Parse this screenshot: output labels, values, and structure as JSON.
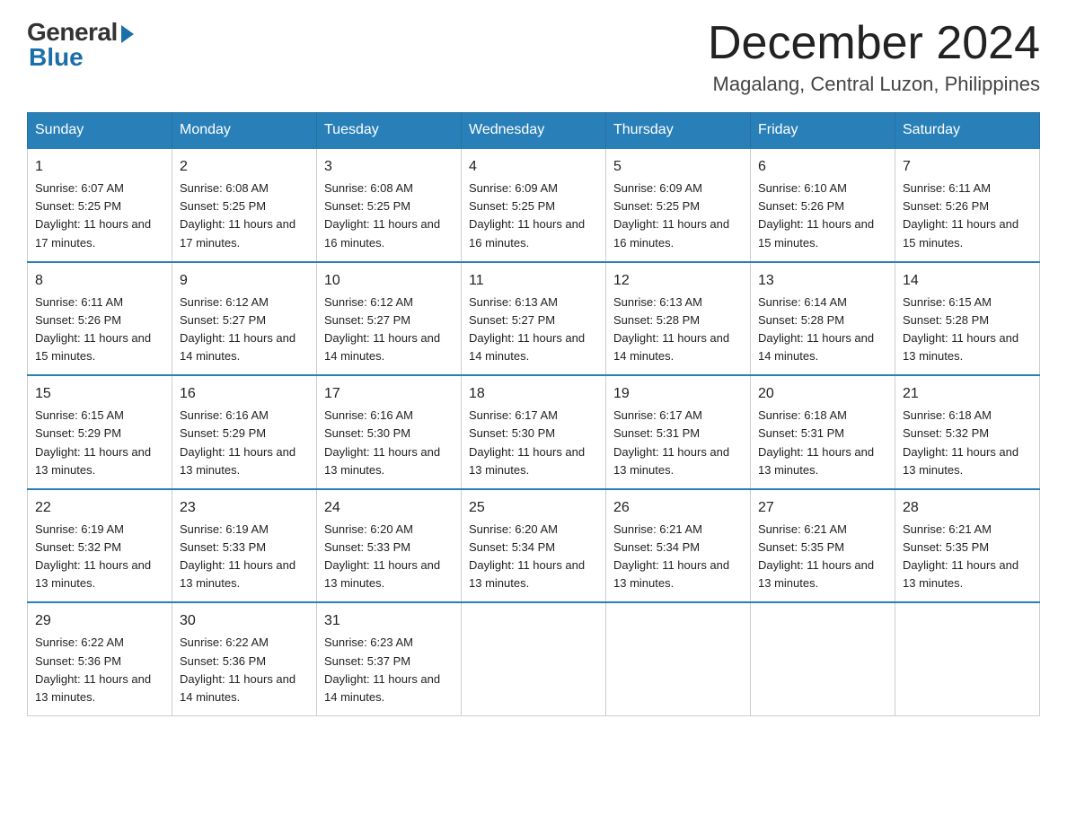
{
  "logo": {
    "general": "General",
    "blue": "Blue"
  },
  "title": "December 2024",
  "location": "Magalang, Central Luzon, Philippines",
  "days_of_week": [
    "Sunday",
    "Monday",
    "Tuesday",
    "Wednesday",
    "Thursday",
    "Friday",
    "Saturday"
  ],
  "weeks": [
    [
      {
        "day": "1",
        "sunrise": "6:07 AM",
        "sunset": "5:25 PM",
        "daylight": "11 hours and 17 minutes."
      },
      {
        "day": "2",
        "sunrise": "6:08 AM",
        "sunset": "5:25 PM",
        "daylight": "11 hours and 17 minutes."
      },
      {
        "day": "3",
        "sunrise": "6:08 AM",
        "sunset": "5:25 PM",
        "daylight": "11 hours and 16 minutes."
      },
      {
        "day": "4",
        "sunrise": "6:09 AM",
        "sunset": "5:25 PM",
        "daylight": "11 hours and 16 minutes."
      },
      {
        "day": "5",
        "sunrise": "6:09 AM",
        "sunset": "5:25 PM",
        "daylight": "11 hours and 16 minutes."
      },
      {
        "day": "6",
        "sunrise": "6:10 AM",
        "sunset": "5:26 PM",
        "daylight": "11 hours and 15 minutes."
      },
      {
        "day": "7",
        "sunrise": "6:11 AM",
        "sunset": "5:26 PM",
        "daylight": "11 hours and 15 minutes."
      }
    ],
    [
      {
        "day": "8",
        "sunrise": "6:11 AM",
        "sunset": "5:26 PM",
        "daylight": "11 hours and 15 minutes."
      },
      {
        "day": "9",
        "sunrise": "6:12 AM",
        "sunset": "5:27 PM",
        "daylight": "11 hours and 14 minutes."
      },
      {
        "day": "10",
        "sunrise": "6:12 AM",
        "sunset": "5:27 PM",
        "daylight": "11 hours and 14 minutes."
      },
      {
        "day": "11",
        "sunrise": "6:13 AM",
        "sunset": "5:27 PM",
        "daylight": "11 hours and 14 minutes."
      },
      {
        "day": "12",
        "sunrise": "6:13 AM",
        "sunset": "5:28 PM",
        "daylight": "11 hours and 14 minutes."
      },
      {
        "day": "13",
        "sunrise": "6:14 AM",
        "sunset": "5:28 PM",
        "daylight": "11 hours and 14 minutes."
      },
      {
        "day": "14",
        "sunrise": "6:15 AM",
        "sunset": "5:28 PM",
        "daylight": "11 hours and 13 minutes."
      }
    ],
    [
      {
        "day": "15",
        "sunrise": "6:15 AM",
        "sunset": "5:29 PM",
        "daylight": "11 hours and 13 minutes."
      },
      {
        "day": "16",
        "sunrise": "6:16 AM",
        "sunset": "5:29 PM",
        "daylight": "11 hours and 13 minutes."
      },
      {
        "day": "17",
        "sunrise": "6:16 AM",
        "sunset": "5:30 PM",
        "daylight": "11 hours and 13 minutes."
      },
      {
        "day": "18",
        "sunrise": "6:17 AM",
        "sunset": "5:30 PM",
        "daylight": "11 hours and 13 minutes."
      },
      {
        "day": "19",
        "sunrise": "6:17 AM",
        "sunset": "5:31 PM",
        "daylight": "11 hours and 13 minutes."
      },
      {
        "day": "20",
        "sunrise": "6:18 AM",
        "sunset": "5:31 PM",
        "daylight": "11 hours and 13 minutes."
      },
      {
        "day": "21",
        "sunrise": "6:18 AM",
        "sunset": "5:32 PM",
        "daylight": "11 hours and 13 minutes."
      }
    ],
    [
      {
        "day": "22",
        "sunrise": "6:19 AM",
        "sunset": "5:32 PM",
        "daylight": "11 hours and 13 minutes."
      },
      {
        "day": "23",
        "sunrise": "6:19 AM",
        "sunset": "5:33 PM",
        "daylight": "11 hours and 13 minutes."
      },
      {
        "day": "24",
        "sunrise": "6:20 AM",
        "sunset": "5:33 PM",
        "daylight": "11 hours and 13 minutes."
      },
      {
        "day": "25",
        "sunrise": "6:20 AM",
        "sunset": "5:34 PM",
        "daylight": "11 hours and 13 minutes."
      },
      {
        "day": "26",
        "sunrise": "6:21 AM",
        "sunset": "5:34 PM",
        "daylight": "11 hours and 13 minutes."
      },
      {
        "day": "27",
        "sunrise": "6:21 AM",
        "sunset": "5:35 PM",
        "daylight": "11 hours and 13 minutes."
      },
      {
        "day": "28",
        "sunrise": "6:21 AM",
        "sunset": "5:35 PM",
        "daylight": "11 hours and 13 minutes."
      }
    ],
    [
      {
        "day": "29",
        "sunrise": "6:22 AM",
        "sunset": "5:36 PM",
        "daylight": "11 hours and 13 minutes."
      },
      {
        "day": "30",
        "sunrise": "6:22 AM",
        "sunset": "5:36 PM",
        "daylight": "11 hours and 14 minutes."
      },
      {
        "day": "31",
        "sunrise": "6:23 AM",
        "sunset": "5:37 PM",
        "daylight": "11 hours and 14 minutes."
      },
      null,
      null,
      null,
      null
    ]
  ]
}
